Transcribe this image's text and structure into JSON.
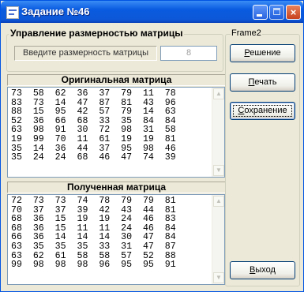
{
  "window": {
    "title": "Задание №46",
    "minimize_label": "",
    "close_glyph": "×"
  },
  "dimension_group": {
    "label": "Управление размерностью матрицы",
    "prompt": "Введите размерность матрицы",
    "value": "8"
  },
  "frame2": {
    "label": "Frame2",
    "buttons": [
      {
        "mnemonic": "Р",
        "rest": "ешение"
      },
      {
        "mnemonic": "П",
        "rest": "ечать"
      },
      {
        "mnemonic": "С",
        "rest": "охранение"
      },
      {
        "mnemonic": "В",
        "rest": "ыход"
      }
    ]
  },
  "original": {
    "heading": "Оригинальная матрица",
    "rows": [
      "73  58  62  36  37  79  11  78",
      "83  73  14  47  87  81  43  96",
      "88  15  95  42  57  79  14  63",
      "52  36  66  68  33  35  84  84",
      "63  98  91  30  72  98  31  58",
      "19  99  70  11  61  19  19  81",
      "35  14  36  44  37  95  98  46",
      "35  24  24  68  46  47  74  39"
    ]
  },
  "result": {
    "heading": "Полученная матрица",
    "rows": [
      "72  73  73  74  78  79  79  81",
      "70  37  37  39  42  43  44  81",
      "68  36  15  19  19  24  46  83",
      "68  36  15  11  11  24  46  84",
      "66  36  14  14  14  30  47  84",
      "63  35  35  35  33  31  47  87",
      "63  62  61  58  58  57  52  88",
      "99  98  98  98  96  95  95  91"
    ]
  }
}
